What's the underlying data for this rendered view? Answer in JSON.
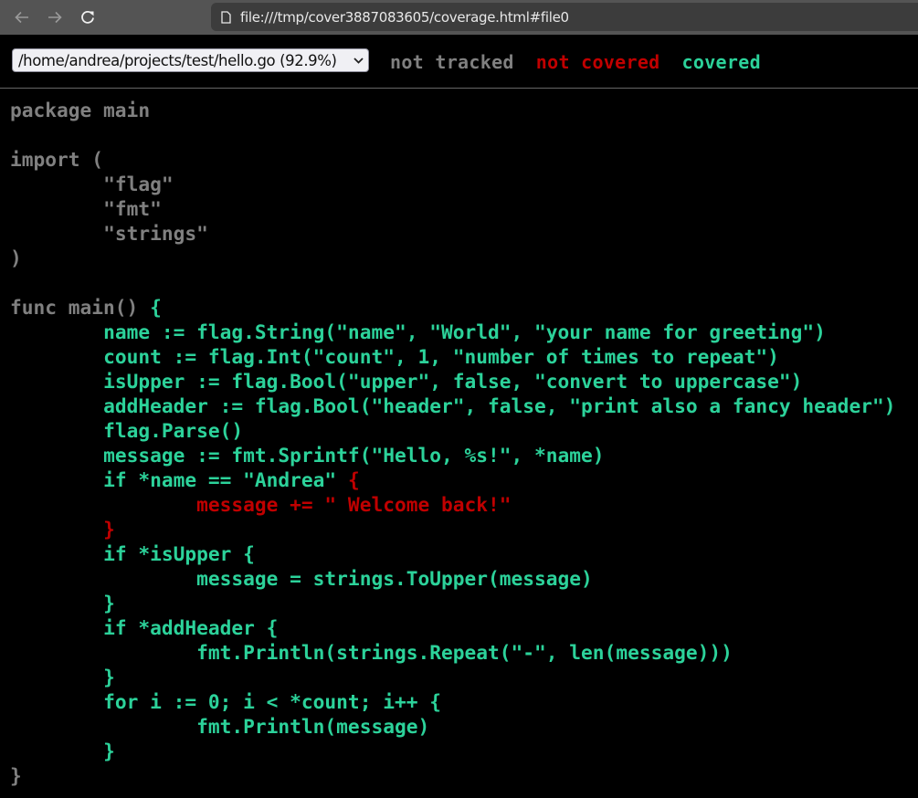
{
  "browser": {
    "url": "file:///tmp/cover3887083605/coverage.html#file0",
    "icons": [
      "back-arrow-icon",
      "forward-arrow-icon",
      "reload-icon",
      "page-icon"
    ]
  },
  "colors": {
    "not_tracked": "#808080",
    "not_covered": "#c00000",
    "covered": "#2cd29a",
    "background": "#000000"
  },
  "topbar": {
    "file_select": {
      "selected": "/home/andrea/projects/test/hello.go (92.9%)",
      "file": "/home/andrea/projects/test/hello.go",
      "coverage_percent": 92.9
    },
    "legend": {
      "not_tracked": "not tracked",
      "not_covered": "not covered",
      "covered": "covered"
    }
  },
  "code": {
    "lines": [
      [
        {
          "t": "package main",
          "c": "nt"
        }
      ],
      [
        {
          "t": "",
          "c": "nt"
        }
      ],
      [
        {
          "t": "import (",
          "c": "nt"
        }
      ],
      [
        {
          "t": "\t\"flag\"",
          "c": "nt"
        }
      ],
      [
        {
          "t": "\t\"fmt\"",
          "c": "nt"
        }
      ],
      [
        {
          "t": "\t\"strings\"",
          "c": "nt"
        }
      ],
      [
        {
          "t": ")",
          "c": "nt"
        }
      ],
      [
        {
          "t": "",
          "c": "nt"
        }
      ],
      [
        {
          "t": "func main() ",
          "c": "nt"
        },
        {
          "t": "{",
          "c": "cov8"
        }
      ],
      [
        {
          "t": "\tname := flag.String(\"name\", \"World\", \"your name for greeting\")",
          "c": "cov8"
        }
      ],
      [
        {
          "t": "\tcount := flag.Int(\"count\", 1, \"number of times to repeat\")",
          "c": "cov8"
        }
      ],
      [
        {
          "t": "\tisUpper := flag.Bool(\"upper\", false, \"convert to uppercase\")",
          "c": "cov8"
        }
      ],
      [
        {
          "t": "\taddHeader := flag.Bool(\"header\", false, \"print also a fancy header\")",
          "c": "cov8"
        }
      ],
      [
        {
          "t": "\tflag.Parse()",
          "c": "cov8"
        }
      ],
      [
        {
          "t": "\tmessage := fmt.Sprintf(\"Hello, %s!\", *name)",
          "c": "cov8"
        }
      ],
      [
        {
          "t": "\tif *name == \"Andrea\" ",
          "c": "cov8"
        },
        {
          "t": "{",
          "c": "cov0"
        }
      ],
      [
        {
          "t": "\t\tmessage += \" Welcome back!\"",
          "c": "cov0"
        }
      ],
      [
        {
          "t": "\t}",
          "c": "cov0"
        }
      ],
      [
        {
          "t": "\tif *isUpper {",
          "c": "cov8"
        }
      ],
      [
        {
          "t": "\t\tmessage = strings.ToUpper(message)",
          "c": "cov8"
        }
      ],
      [
        {
          "t": "\t}",
          "c": "cov8"
        }
      ],
      [
        {
          "t": "\tif *addHeader {",
          "c": "cov8"
        }
      ],
      [
        {
          "t": "\t\tfmt.Println(strings.Repeat(\"-\", len(message)))",
          "c": "cov8"
        }
      ],
      [
        {
          "t": "\t}",
          "c": "cov8"
        }
      ],
      [
        {
          "t": "\tfor i := 0; i < *count; i++ {",
          "c": "cov8"
        }
      ],
      [
        {
          "t": "\t\tfmt.Println(message)",
          "c": "cov8"
        }
      ],
      [
        {
          "t": "\t}",
          "c": "cov8"
        }
      ],
      [
        {
          "t": "}",
          "c": "nt"
        }
      ]
    ]
  }
}
